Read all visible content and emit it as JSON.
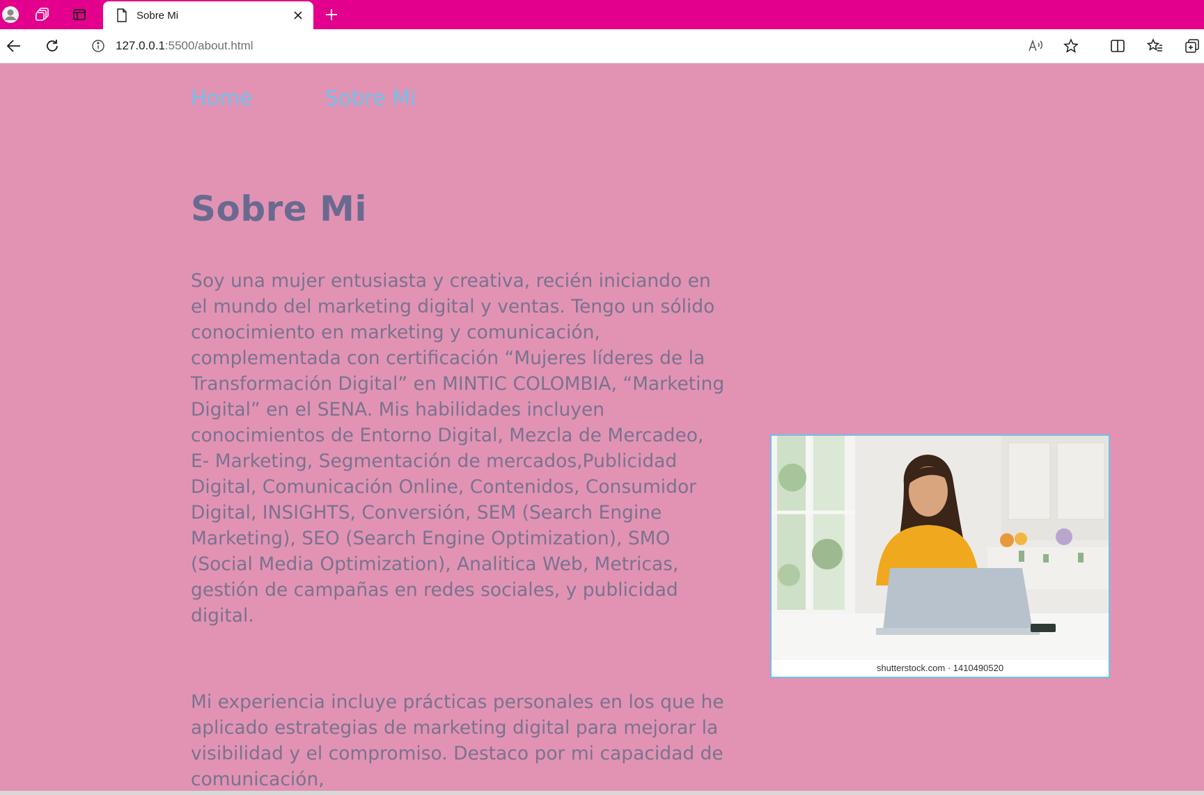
{
  "browser": {
    "tab_title": "Sobre Mi",
    "url_host": "127.0.0.1",
    "url_rest": ":5500/about.html"
  },
  "icons": {
    "profile": "profile-icon",
    "workspaces": "workspaces-icon",
    "tab_actions": "tab-actions-icon",
    "page": "page-icon",
    "close": "close-icon",
    "new_tab": "plus-icon",
    "back": "back-arrow-icon",
    "refresh": "refresh-icon",
    "info": "info-icon",
    "read_aloud": "read-aloud-icon",
    "favorite": "star-icon",
    "split_screen": "split-screen-icon",
    "favorites": "favorites-icon",
    "collections": "collections-icon"
  },
  "nav": {
    "items": [
      "Home",
      "Sobre Mi"
    ]
  },
  "main": {
    "heading": "Sobre Mi",
    "paragraph_1": "Soy una mujer entusiasta y creativa, recién iniciando en el mundo del marketing digital y ventas. Tengo un sólido conocimiento en marketing y comunicación, complementada con certificación “Mujeres líderes de la Transformación Digital” en MINTIC COLOMBIA, “Marketing Digital” en el SENA. Mis habilidades incluyen conocimientos de Entorno Digital, Mezcla de Mercadeo, E- Marketing, Segmentación de mercados,Publicidad Digital, Comunicación Online, Contenidos, Consumidor Digital, INSIGHTS, Conversión, SEM (Search Engine Marketing), SEO (Search Engine Optimization), SMO (Social Media Optimization), Analitica Web, Metricas, gestión de campañas en redes sociales, y publicidad digital.",
    "paragraph_2": "Mi experiencia incluye prácticas personales en los que he aplicado estrategias de marketing digital para mejorar la visibilidad y el compromiso. Destaco por mi capacidad de comunicación,",
    "photo_caption": "shutterstock.com · 1410490520"
  },
  "colors": {
    "tabbar": "#e3008c",
    "page_background": "#e293b3",
    "nav_link": "#6ec1ec",
    "heading": "#6a6a90",
    "body_text": "#7a7290"
  }
}
